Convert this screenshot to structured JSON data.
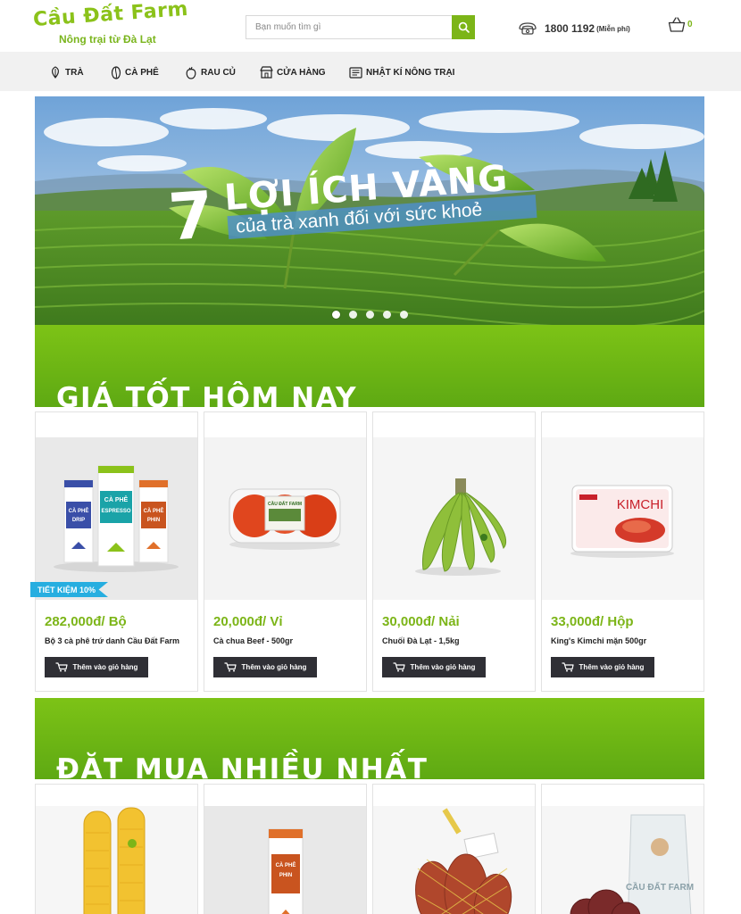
{
  "header": {
    "brand": "Cầu Đất Farm",
    "tagline": "Nông trại từ Đà Lạt",
    "search_placeholder": "Bạn muốn tìm gì",
    "hotline_number": "1800 1192",
    "hotline_note": "(Miễn phí)",
    "cart_count": "0"
  },
  "nav": {
    "items": [
      {
        "label": "TRÀ",
        "icon": "tea-leaf-icon"
      },
      {
        "label": "CÀ PHÊ",
        "icon": "coffee-bean-icon"
      },
      {
        "label": "RAU CỦ",
        "icon": "vegetable-icon"
      },
      {
        "label": "CỬA HÀNG",
        "icon": "store-icon"
      },
      {
        "label": "NHẬT KÍ NÔNG TRẠI",
        "icon": "journal-icon"
      }
    ]
  },
  "hero": {
    "number": "7",
    "headline": "LỢI ÍCH VÀNG",
    "subline": "của trà xanh đối với sức khoẻ",
    "slides": 5,
    "active_slide": 1
  },
  "sections": {
    "deals_title": "GIÁ TỐT HÔM NAY",
    "bestseller_title": "ĐẶT MUA NHIỀU NHẤT"
  },
  "deals": [
    {
      "price": "282,000đ/ Bộ",
      "name": "Bộ 3 cà phê trứ danh Cầu Đất Farm",
      "badge": "TIẾT KIỆM 10%",
      "image": "coffee-set-image",
      "packs": [
        {
          "l1": "CÀ PHÊ",
          "l2": "DRIP"
        },
        {
          "l1": "CÀ PHÊ",
          "l2": "ESPRESSO"
        },
        {
          "l1": "CÀ PHÊ",
          "l2": "PHIN"
        }
      ]
    },
    {
      "price": "20,000đ/ Vỉ",
      "name": "Cà chua Beef - 500gr",
      "image": "tomato-pack-image",
      "label": "CẦU ĐẤT FARM"
    },
    {
      "price": "30,000đ/ Nải",
      "name": "Chuối Đà Lạt - 1,5kg",
      "image": "banana-image"
    },
    {
      "price": "33,000đ/ Hộp",
      "name": "King's Kimchi mặn 500gr",
      "image": "kimchi-box-image",
      "label": "KIMCHI"
    }
  ],
  "bestsellers": [
    {
      "image": "corn-image"
    },
    {
      "image": "coffee-phin-bag-image",
      "l1": "CÀ PHÊ",
      "l2": "PHIN"
    },
    {
      "image": "sweet-potato-image"
    },
    {
      "image": "lettuce-bag-image",
      "label": "CẦU ĐẤT FARM"
    }
  ],
  "add_to_cart_label": "Thêm vào giỏ hàng",
  "colors": {
    "brand_green": "#7cb518",
    "button_dark": "#2f2f35",
    "badge_blue": "#27aee0",
    "nav_bg": "#f1f1f1"
  }
}
